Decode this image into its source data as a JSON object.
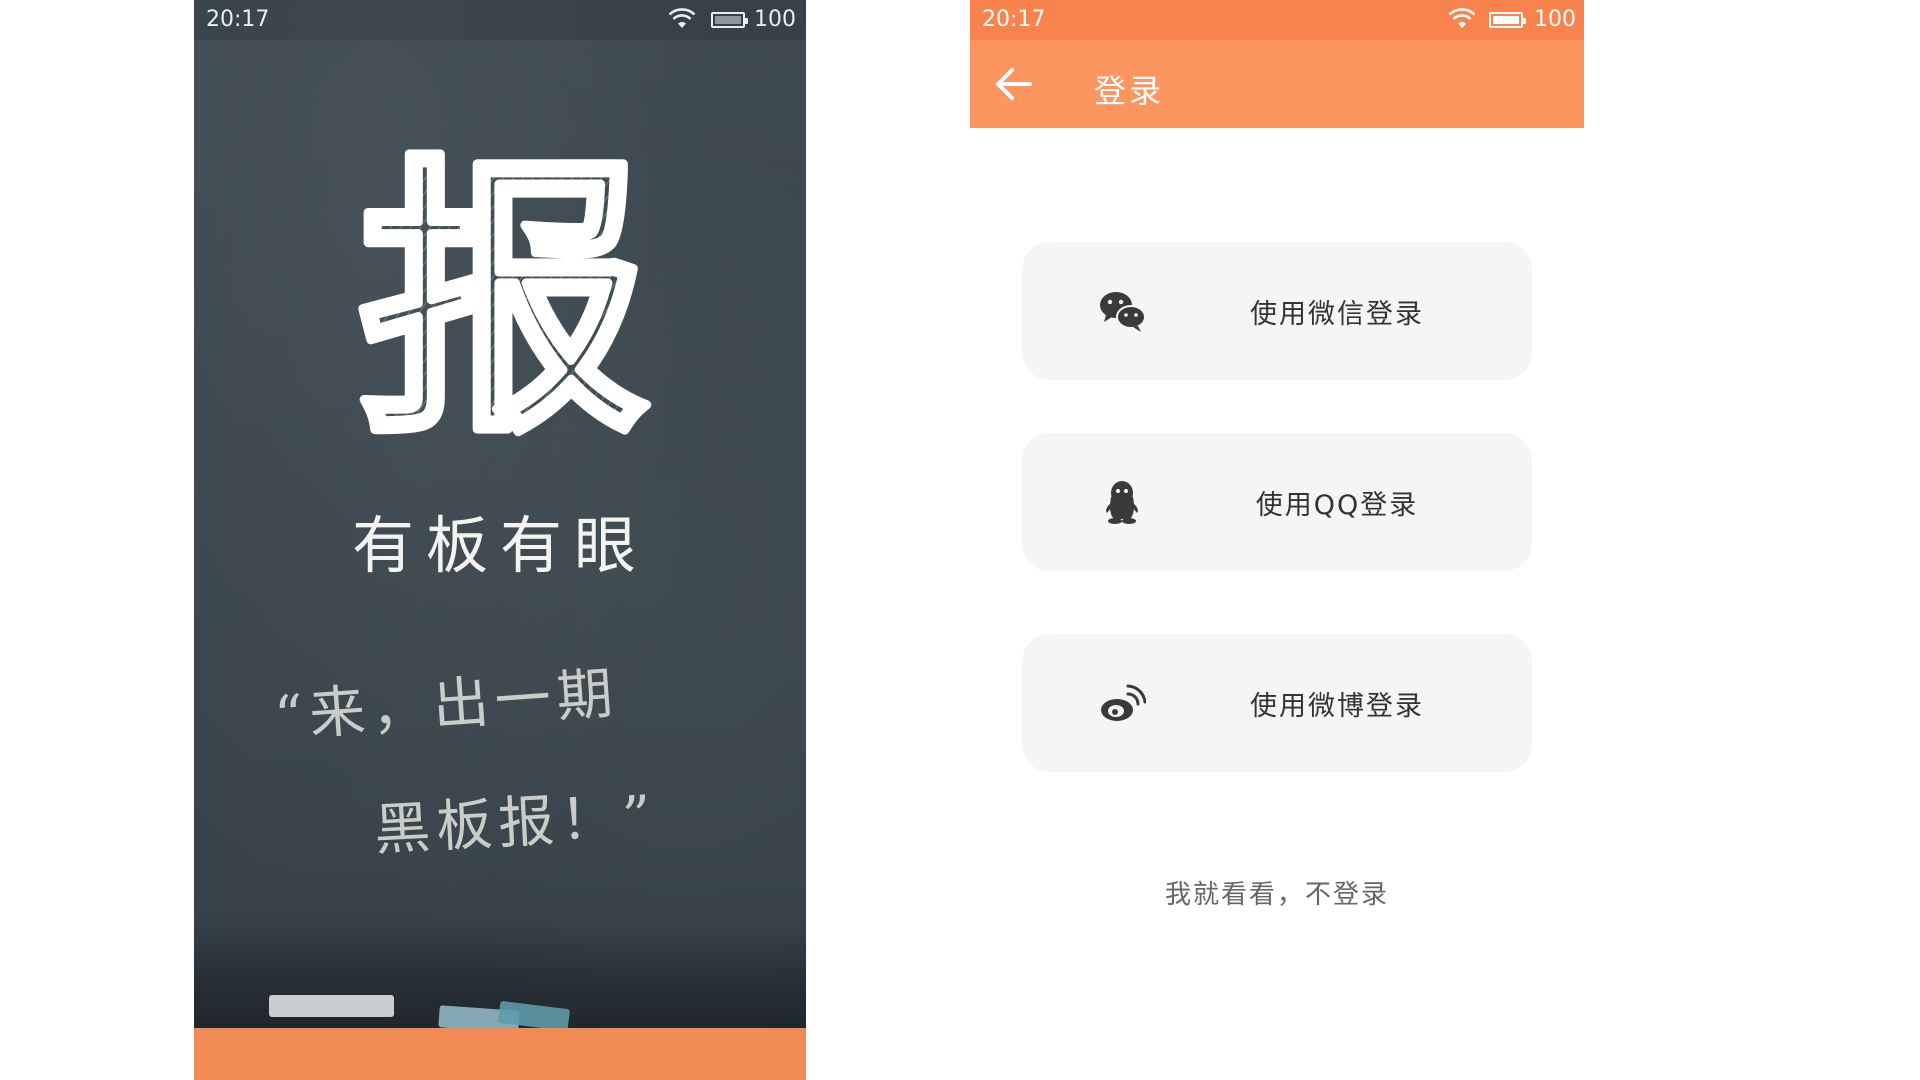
{
  "splash": {
    "status_time": "20:17",
    "battery": "100",
    "logo_char": "报",
    "slogan": "有板有眼",
    "quote_line1": "“来，出一期",
    "quote_line2": "黑板报！”",
    "accent_color": "#f08b56"
  },
  "login": {
    "status_time": "20:17",
    "battery": "100",
    "title": "登录",
    "buttons": [
      {
        "label": "使用微信登录",
        "icon": "wechat-icon"
      },
      {
        "label": "使用QQ登录",
        "icon": "qq-penguin-icon"
      },
      {
        "label": "使用微博登录",
        "icon": "weibo-icon"
      }
    ],
    "skip_label": "我就看看，不登录",
    "header_color": "#fd9561",
    "button_bg": "#f5f5f5"
  }
}
